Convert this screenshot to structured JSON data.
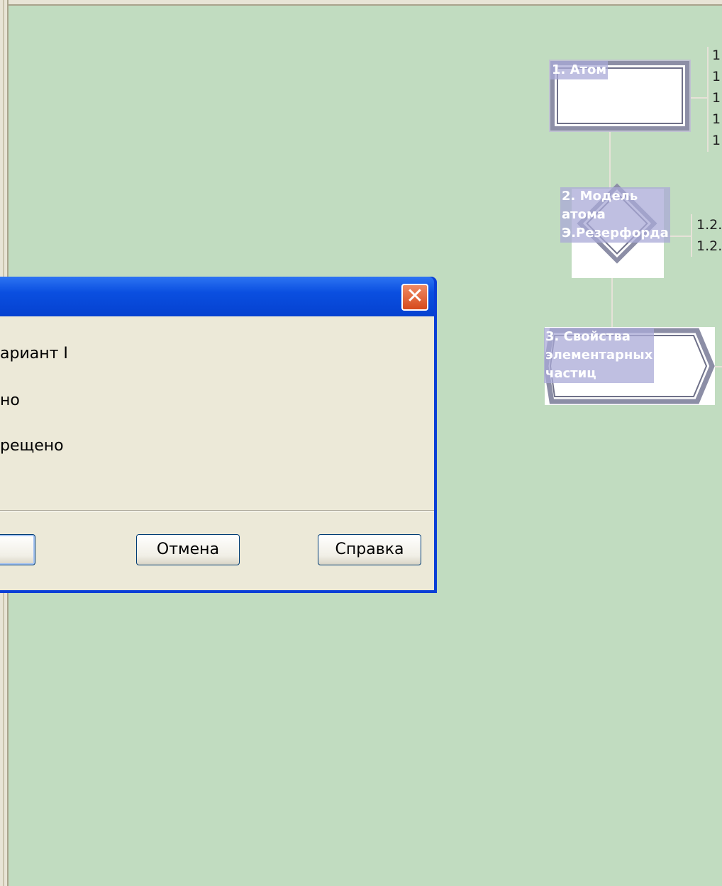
{
  "diagram": {
    "nodes": [
      {
        "label": "1. Атом"
      },
      {
        "label": "2. Модель\nатома\nЭ.Резерфорда"
      },
      {
        "label": "3. Свойства\nэлементарных\nчастиц"
      }
    ],
    "side_lists": [
      {
        "items": [
          "1",
          "1",
          "1",
          "1",
          "1"
        ]
      },
      {
        "items": [
          "1.2.",
          "1.2."
        ]
      }
    ]
  },
  "dialog": {
    "close_label": "✕",
    "options": [
      "ариант I",
      "но",
      "рещено"
    ],
    "buttons": {
      "cancel": "Отмена",
      "help": "Справка",
      "ok": ""
    }
  },
  "colors": {
    "canvas_bg": "#c1dcc0",
    "dialog_title": "#0a4fe0",
    "dialog_body": "#ece9d8",
    "close_button": "#d64a1d"
  }
}
